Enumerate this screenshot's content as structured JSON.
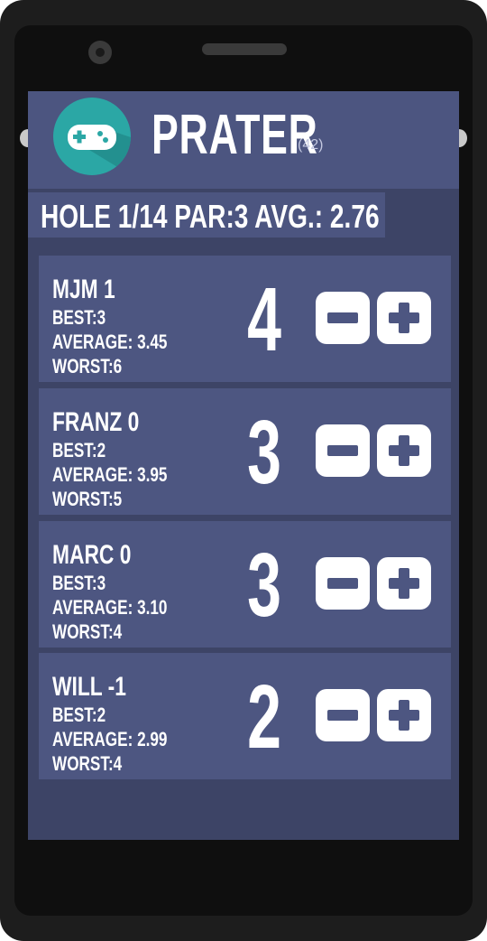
{
  "app": {
    "title": "PRATER",
    "count": "(42)",
    "icon": "gamepad-icon"
  },
  "hole_info": "HOLE 1/14 PAR:3 AVG.: 2.76",
  "players": [
    {
      "name": "MJM 1",
      "best": "BEST:3",
      "average": "AVERAGE: 3.45",
      "worst": "WORST:6",
      "score": "4"
    },
    {
      "name": "FRANZ 0",
      "best": "BEST:2",
      "average": "AVERAGE: 3.95",
      "worst": "WORST:5",
      "score": "3"
    },
    {
      "name": "MARC 0",
      "best": "BEST:3",
      "average": "AVERAGE: 3.10",
      "worst": "WORST:4",
      "score": "3"
    },
    {
      "name": "WILL -1",
      "best": "BEST:2",
      "average": "AVERAGE: 2.99",
      "worst": "WORST:4",
      "score": "2"
    }
  ],
  "buttons": {
    "decrement_icon": "minus-icon",
    "increment_icon": "plus-icon"
  },
  "colors": {
    "header": "#4c5580",
    "background": "#3d4466",
    "card": "#4d5681",
    "icon_teal": "#2ba7a5"
  }
}
